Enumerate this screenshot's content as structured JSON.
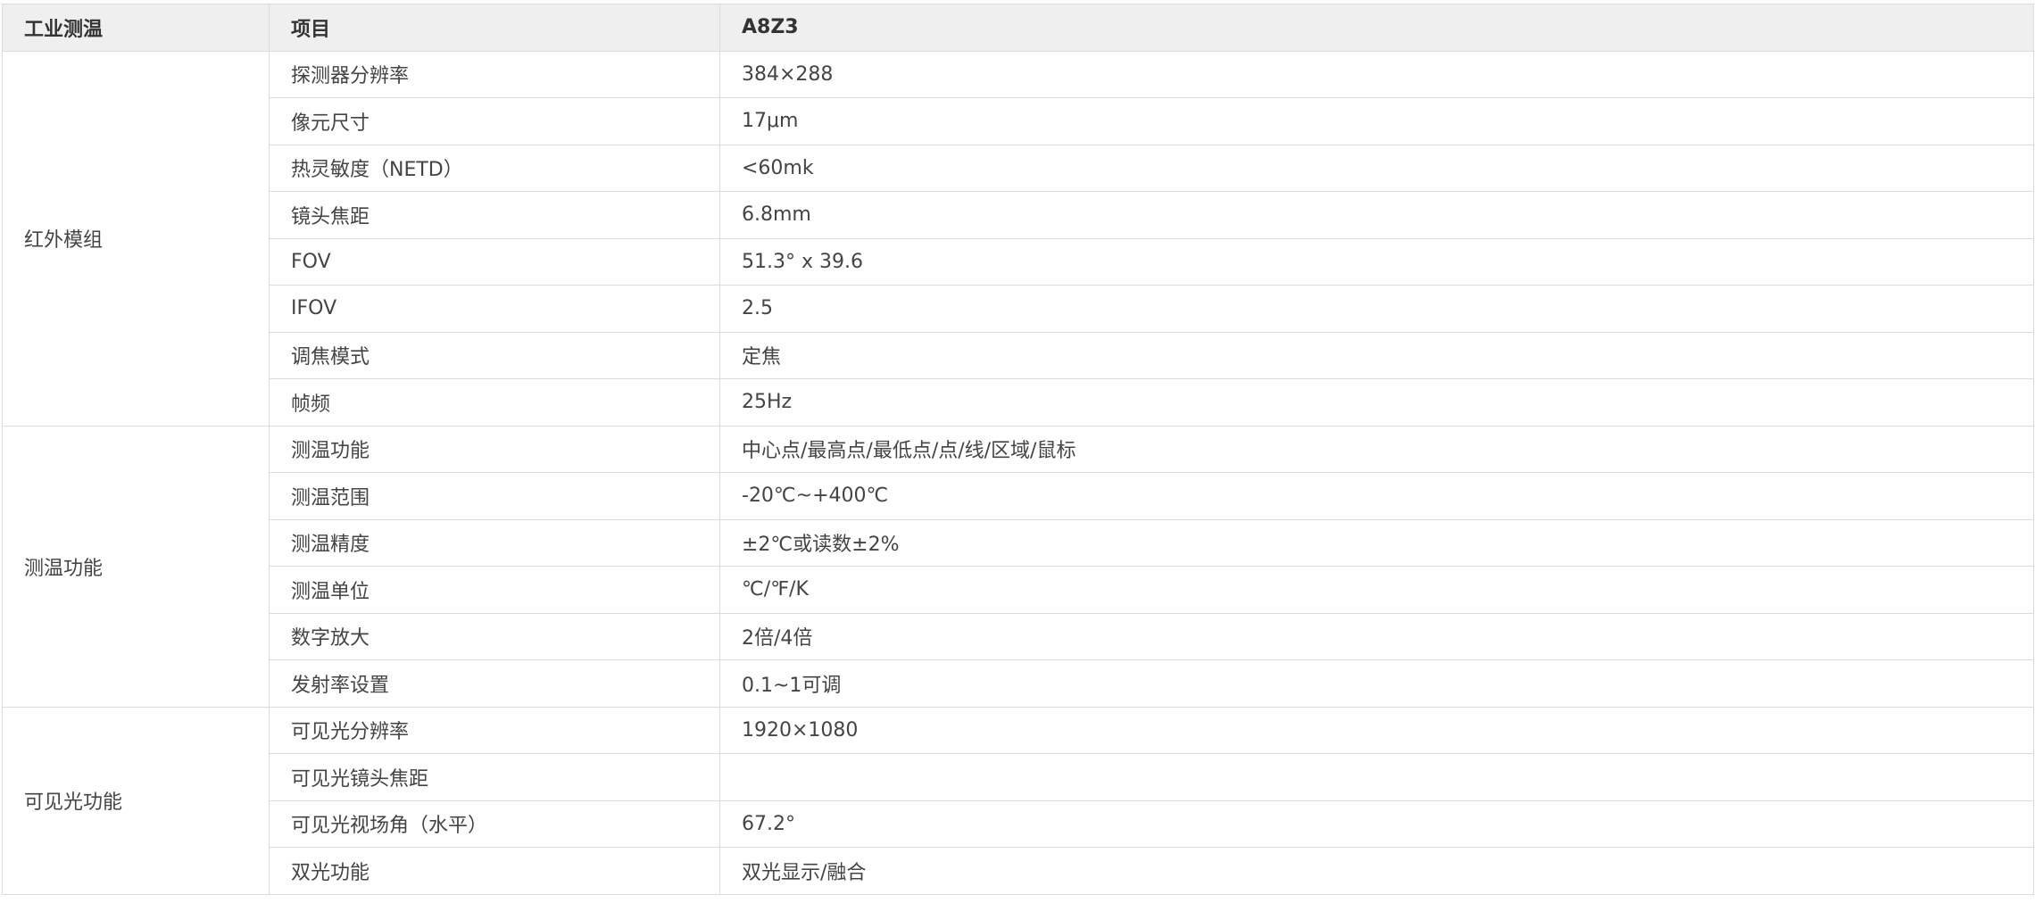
{
  "table": {
    "headers": [
      "工业测温",
      "项目",
      "A8Z3"
    ],
    "groups": [
      {
        "name": "红外模组",
        "rows": [
          {
            "item": "探测器分辨率",
            "value": "384×288"
          },
          {
            "item": "像元尺寸",
            "value": "17μm"
          },
          {
            "item": "热灵敏度（NETD）",
            "value": "<60mk"
          },
          {
            "item": "镜头焦距",
            "value": "6.8mm"
          },
          {
            "item": "FOV",
            "value": "51.3° x 39.6"
          },
          {
            "item": "IFOV",
            "value": "2.5"
          },
          {
            "item": "调焦模式",
            "value": "定焦"
          },
          {
            "item": "帧频",
            "value": "25Hz"
          }
        ]
      },
      {
        "name": "测温功能",
        "rows": [
          {
            "item": "测温功能",
            "value": "中心点/最高点/最低点/点/线/区域/鼠标"
          },
          {
            "item": "测温范围",
            "value": "-20℃~+400℃"
          },
          {
            "item": "测温精度",
            "value": "±2℃或读数±2%"
          },
          {
            "item": "测温单位",
            "value": "℃/℉/K"
          },
          {
            "item": "数字放大",
            "value": "2倍/4倍"
          },
          {
            "item": "发射率设置",
            "value": "0.1~1可调"
          }
        ]
      },
      {
        "name": "可见光功能",
        "rows": [
          {
            "item": "可见光分辨率",
            "value": "1920×1080"
          },
          {
            "item": "可见光镜头焦距",
            "value": ""
          },
          {
            "item": "可见光视场角（水平）",
            "value": "67.2°"
          },
          {
            "item": "双光功能",
            "value": "双光显示/融合"
          }
        ]
      }
    ]
  }
}
